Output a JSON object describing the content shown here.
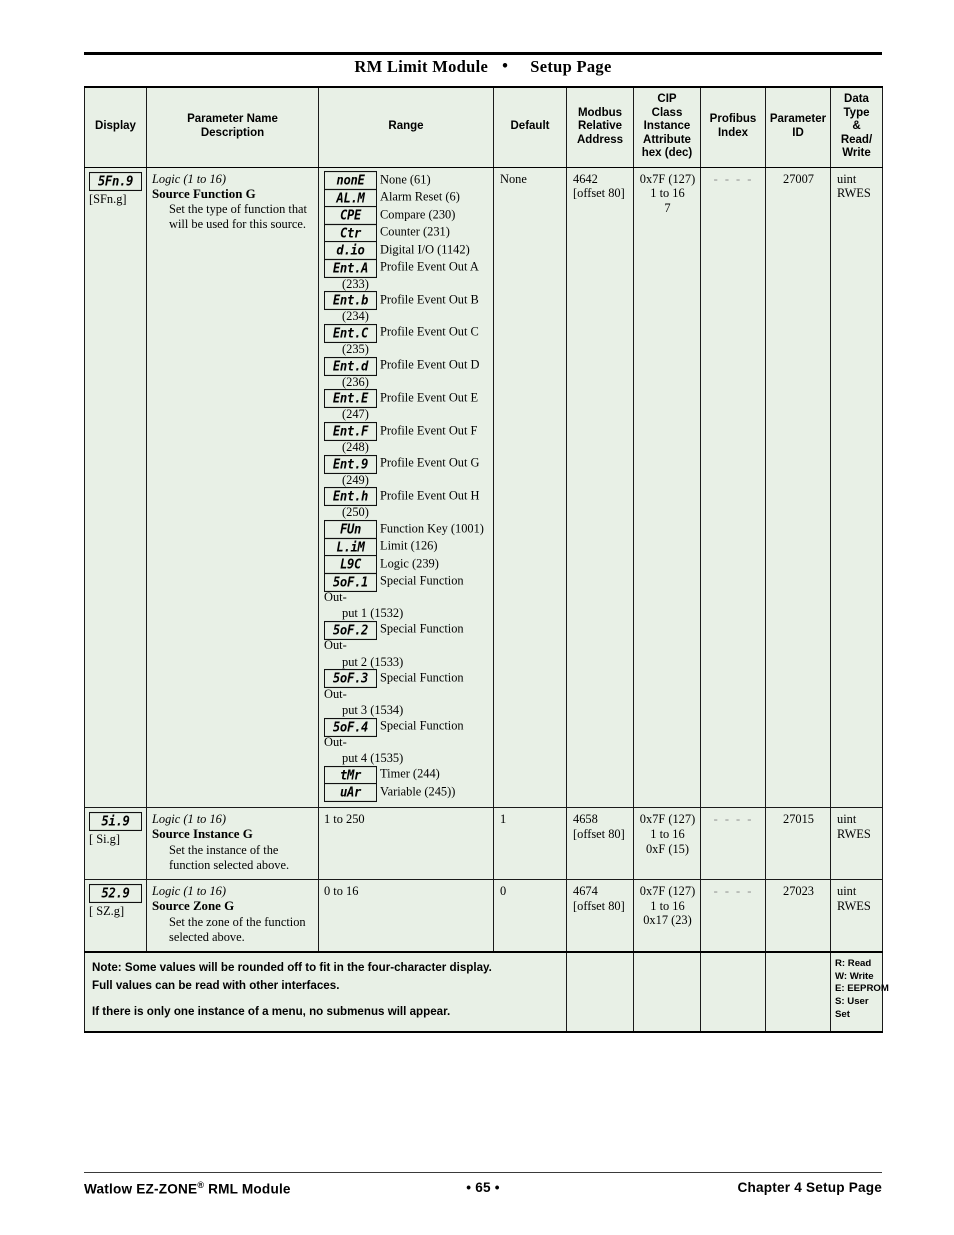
{
  "header": {
    "title_a": "RM Limit Module",
    "separator": "•",
    "title_b": "Setup Page"
  },
  "table": {
    "columns": [
      {
        "key": "display",
        "label": "Display"
      },
      {
        "key": "param",
        "label": "Parameter Name\nDescription"
      },
      {
        "key": "range",
        "label": "Range"
      },
      {
        "key": "default",
        "label": "Default"
      },
      {
        "key": "modbus",
        "label": "Modbus\nRelative\nAddress"
      },
      {
        "key": "cip",
        "label": "CIP\nClass\nInstance\nAttribute\nhex (dec)"
      },
      {
        "key": "profibus",
        "label": "Profibus\nIndex"
      },
      {
        "key": "paramid",
        "label": "Parameter\nID"
      },
      {
        "key": "datatype",
        "label": "Data\nType\n&\nRead/\nWrite"
      }
    ],
    "header_labels": {
      "display": "Display",
      "param_l1": "Parameter Name",
      "param_l2": "Description",
      "range": "Range",
      "default": "Default",
      "modbus_l1": "Modbus",
      "modbus_l2": "Relative",
      "modbus_l3": "Address",
      "cip_l1": "CIP",
      "cip_l2": "Class",
      "cip_l3": "Instance",
      "cip_l4": "Attribute",
      "cip_l5": "hex (dec)",
      "profibus_l1": "Profibus",
      "profibus_l2": "Index",
      "paramid_l1": "Parameter",
      "paramid_l2": "ID",
      "datatype_l1": "Data",
      "datatype_l2": "Type",
      "datatype_l3": "&",
      "datatype_l4": "Read/",
      "datatype_l5": "Write"
    },
    "rows": [
      {
        "display_seg": "5Fn.9",
        "display_alt": "[SFn.g]",
        "condition": "Logic (1 to 16)",
        "name": "Source Function G",
        "description": "Set the type of function that will be used for this source.",
        "range_options": [
          {
            "seg": "nonE",
            "text": "None (61)"
          },
          {
            "seg": "AL.M",
            "text": "Alarm Reset (6)"
          },
          {
            "seg": "CPE",
            "text": "Compare (230)"
          },
          {
            "seg": "Ctr",
            "text": "Counter (231)"
          },
          {
            "seg": "d.io",
            "text": "Digital I/O (1142)"
          },
          {
            "seg": "Ent.A",
            "text": "Profile Event Out A",
            "cont": "(233)"
          },
          {
            "seg": "Ent.b",
            "text": "Profile Event Out B",
            "cont": "(234)"
          },
          {
            "seg": "Ent.C",
            "text": "Profile Event Out C",
            "cont": "(235)"
          },
          {
            "seg": "Ent.d",
            "text": "Profile Event Out D",
            "cont": "(236)"
          },
          {
            "seg": "Ent.E",
            "text": "Profile Event Out E",
            "cont": "(247)"
          },
          {
            "seg": "Ent.F",
            "text": "Profile Event Out F",
            "cont": "(248)"
          },
          {
            "seg": "Ent.9",
            "text": "Profile Event Out G",
            "cont": "(249)"
          },
          {
            "seg": "Ent.h",
            "text": "Profile Event Out H",
            "cont": "(250)"
          },
          {
            "seg": "FUn",
            "text": "Function Key (1001)"
          },
          {
            "seg": "L.iM",
            "text": "Limit (126)"
          },
          {
            "seg": "L9C",
            "text": "Logic (239)"
          },
          {
            "seg": "5oF.1",
            "text": "Special Function Out-",
            "cont": "put 1 (1532)"
          },
          {
            "seg": "5oF.2",
            "text": "Special Function Out-",
            "cont": "put 2 (1533)"
          },
          {
            "seg": "5oF.3",
            "text": "Special Function Out-",
            "cont": "put 3 (1534)"
          },
          {
            "seg": "5oF.4",
            "text": "Special Function Out-",
            "cont": "put 4 (1535)"
          },
          {
            "seg": "tMr",
            "text": "Timer (244)"
          },
          {
            "seg": "uAr",
            "text": "Variable (245))"
          }
        ],
        "range_text": "",
        "default": "None",
        "modbus_l1": "4642",
        "modbus_l2": "[offset 80]",
        "cip_l1": "0x7F (127)",
        "cip_l2": "1 to 16",
        "cip_l3": "7",
        "profibus": "- - - -",
        "paramid": "27007",
        "datatype_l1": "uint",
        "datatype_l2": "RWES"
      },
      {
        "display_seg": "5i.9",
        "display_alt": "[ Si.g]",
        "condition": "Logic (1 to 16)",
        "name": "Source Instance G",
        "description": "Set the instance of the function selected above.",
        "range_options": [],
        "range_text": "1 to 250",
        "default": "1",
        "modbus_l1": "4658",
        "modbus_l2": "[offset 80]",
        "cip_l1": "0x7F (127)",
        "cip_l2": "1 to 16",
        "cip_l3": "0xF (15)",
        "profibus": "- - - -",
        "paramid": "27015",
        "datatype_l1": "uint",
        "datatype_l2": "RWES"
      },
      {
        "display_seg": "52.9",
        "display_alt": "[ SZ.g]",
        "condition": "Logic (1 to 16)",
        "name": "Source Zone G",
        "description": "Set the zone of the function selected above.",
        "range_options": [],
        "range_text": "0 to 16",
        "default": "0",
        "modbus_l1": "4674",
        "modbus_l2": "[offset 80]",
        "cip_l1": "0x7F (127)",
        "cip_l2": "1 to 16",
        "cip_l3": "0x17 (23)",
        "profibus": "- - - -",
        "paramid": "27023",
        "datatype_l1": "uint",
        "datatype_l2": "RWES"
      }
    ],
    "note": {
      "line1": "Note: Some values will be rounded off to fit in the four-character display.",
      "line2": "Full values can be read with other interfaces.",
      "line3": "If there is only one instance of a menu, no submenus will appear.",
      "legend": [
        "R: Read",
        "W: Write",
        "E: EEPROM",
        "S: User",
        "Set"
      ]
    }
  },
  "footer": {
    "left_a": "Watlow EZ-ZONE",
    "left_sup": "®",
    "left_b": " RML Module",
    "center": "•  65  •",
    "right": "Chapter 4 Setup Page"
  },
  "colors": {
    "table_bg": "#e8f0e6",
    "border": "#1a1a1a",
    "text": "#000000",
    "dash": "#8a8a8a"
  }
}
